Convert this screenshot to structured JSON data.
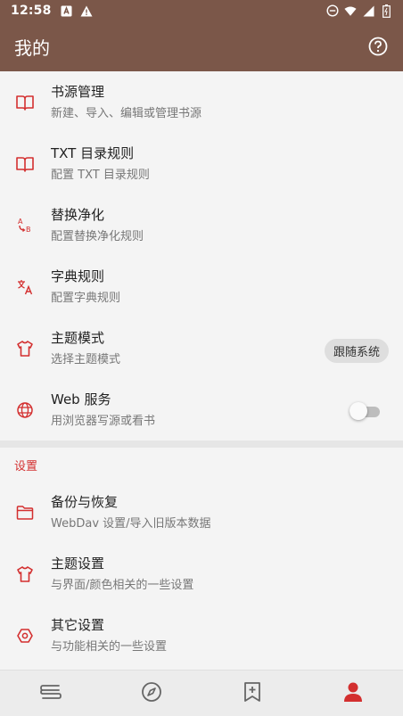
{
  "statusbar": {
    "time": "12:58"
  },
  "appbar": {
    "title": "我的"
  },
  "items_top": [
    {
      "title": "书源管理",
      "subtitle": "新建、导入、编辑或管理书源",
      "icon": "book-icon"
    },
    {
      "title": "TXT 目录规则",
      "subtitle": "配置 TXT 目录规则",
      "icon": "book-icon"
    },
    {
      "title": "替换净化",
      "subtitle": "配置替换净化规则",
      "icon": "replace-icon"
    },
    {
      "title": "字典规则",
      "subtitle": "配置字典规则",
      "icon": "translate-icon"
    },
    {
      "title": "主题模式",
      "subtitle": "选择主题模式",
      "icon": "shirt-icon",
      "value": "跟随系统"
    },
    {
      "title": "Web 服务",
      "subtitle": "用浏览器写源或看书",
      "icon": "globe-icon",
      "toggle": false
    }
  ],
  "settings_section": {
    "title": "设置"
  },
  "items_settings": [
    {
      "title": "备份与恢复",
      "subtitle": "WebDav 设置/导入旧版本数据",
      "icon": "folder-icon"
    },
    {
      "title": "主题设置",
      "subtitle": "与界面/颜色相关的一些设置",
      "icon": "shirt-icon"
    },
    {
      "title": "其它设置",
      "subtitle": "与功能相关的一些设置",
      "icon": "hexagon-icon"
    }
  ],
  "bottom_nav": [
    {
      "name": "bookshelf-icon",
      "active": false
    },
    {
      "name": "compass-icon",
      "active": false
    },
    {
      "name": "rss-bookmark-icon",
      "active": false
    },
    {
      "name": "profile-icon",
      "active": true
    }
  ],
  "colors": {
    "primary": "#7b5749",
    "accent": "#d32f2f"
  }
}
